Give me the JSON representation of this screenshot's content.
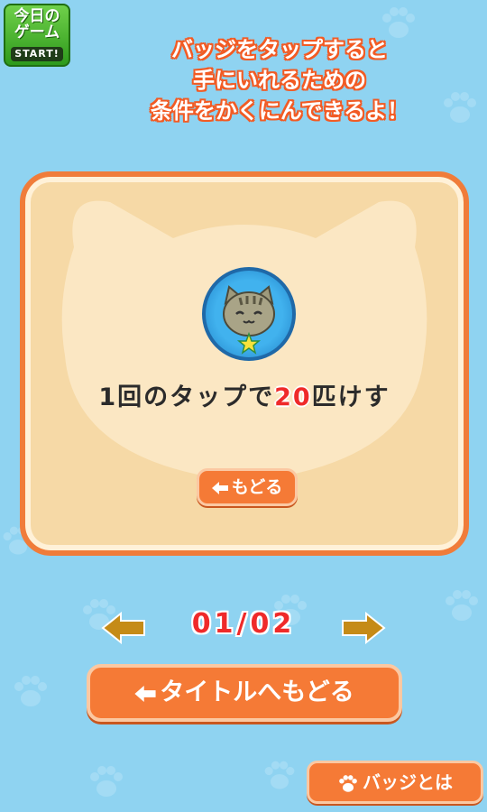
{
  "game_badge": {
    "line1": "今日の",
    "line2": "ゲーム",
    "start": "START!"
  },
  "headline": {
    "line1": "バッジをタップすると",
    "line2": "手にいれるための",
    "line3": "条件をかくにんできるよ！"
  },
  "badge_detail": {
    "condition_prefix": "1回のタップで",
    "count": "20",
    "condition_suffix": "匹けす",
    "back_label": "もどる"
  },
  "pager": {
    "current": "01",
    "separator": "/",
    "total": "02"
  },
  "buttons": {
    "back_to_title": "タイトルへもどる",
    "about_badges": "バッジとは"
  },
  "icons": {
    "cat": "cat-face-icon",
    "star": "star-icon",
    "paw": "paw-icon",
    "left_arrow": "left-arrow-icon",
    "right_arrow": "right-arrow-icon"
  },
  "colors": {
    "background": "#8fd3f1",
    "panel": "#f6d9a6",
    "accent": "#f57a36",
    "highlight_number": "#ef2a2a",
    "badge_blue": "#41b2ee"
  }
}
